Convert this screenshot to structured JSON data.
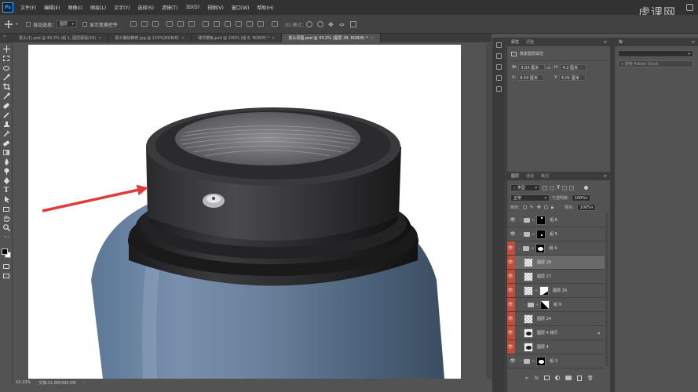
{
  "app": {
    "logo": "Ps",
    "menu": [
      "文件(F)",
      "编辑(E)",
      "图像(I)",
      "图层(L)",
      "文字(Y)",
      "选择(S)",
      "滤镜(T)",
      "3D(D)",
      "视图(V)",
      "窗口(W)",
      "帮助(H)"
    ],
    "watermark": "虎课网"
  },
  "options_bar": {
    "auto_select_label": "自动选择：",
    "auto_select_value": "图层",
    "show_transform_label": "显示变换控件",
    "mode_3d_label": "3D 模式："
  },
  "tabs": [
    {
      "label": "泵头(1).psd @ 49.2% (组 1, 图层蒙版/16)",
      "active": false
    },
    {
      "label": "泵头偏绘精修.jpg @ 110%(RGB/8)",
      "active": false
    },
    {
      "label": "课件模板.psd @ 100% (组 6, RGB/8) *",
      "active": false
    },
    {
      "label": "泵头原图.psd @ 43.2% (图层 28, RGB/8) *",
      "active": true
    }
  ],
  "status": {
    "zoom": "43.19%",
    "doc_info": "文档:21.6M/393.5M"
  },
  "properties": {
    "tabs": [
      "属性",
      "调整"
    ],
    "subtitle": "像素图层属性",
    "w_label": "W:",
    "w_value": "3.03 厘米",
    "h_label": "H:",
    "h_value": "4.2 厘米",
    "x_label": "X:",
    "x_value": "8.59 厘米",
    "y_label": "Y:",
    "y_value": "6.01 厘米",
    "link_glyph": "GO"
  },
  "library": {
    "tab": "库",
    "search_placeholder": "搜索 Adobe Stock"
  },
  "layers_panel": {
    "tabs": [
      "图层",
      "通道",
      "路径"
    ],
    "kind_label": "类型",
    "blend_mode": "正常",
    "opacity_label": "不透明度:",
    "opacity_value": "100%",
    "lock_label": "锁定:",
    "fill_label": "填充:",
    "fill_value": "100%",
    "layers": [
      {
        "name": "组 6",
        "type": "group",
        "visible": true,
        "red": false,
        "selected": false
      },
      {
        "name": "组 5",
        "type": "group",
        "visible": true,
        "red": false,
        "selected": false
      },
      {
        "name": "组 4",
        "type": "group",
        "visible": true,
        "red": true,
        "selected": false
      },
      {
        "name": "图层 28",
        "type": "pixel",
        "visible": true,
        "red": true,
        "selected": true
      },
      {
        "name": "图层 27",
        "type": "pixel",
        "visible": true,
        "red": true,
        "selected": false
      },
      {
        "name": "图层 26",
        "type": "masked",
        "visible": true,
        "red": true,
        "selected": false
      },
      {
        "name": "组 9",
        "type": "group",
        "visible": true,
        "red": true,
        "selected": false
      },
      {
        "name": "图层 24",
        "type": "pixel",
        "visible": true,
        "red": true,
        "selected": false
      },
      {
        "name": "图层 4 拷贝",
        "type": "shape",
        "visible": true,
        "red": true,
        "selected": false
      },
      {
        "name": "图层 4",
        "type": "shape",
        "visible": true,
        "red": true,
        "selected": false
      },
      {
        "name": "组 3",
        "type": "group",
        "visible": true,
        "red": false,
        "selected": false
      }
    ],
    "footer_icons": [
      "link-icon",
      "fx-icon",
      "mask-icon",
      "adjustment-icon",
      "folder-icon",
      "new-layer-icon",
      "trash-icon"
    ]
  },
  "colors": {
    "accent_red_arrow": "#e03c3c",
    "layer_color_tag": "#c44a3a",
    "panel_bg": "#535353",
    "menubar_bg": "#323232"
  }
}
